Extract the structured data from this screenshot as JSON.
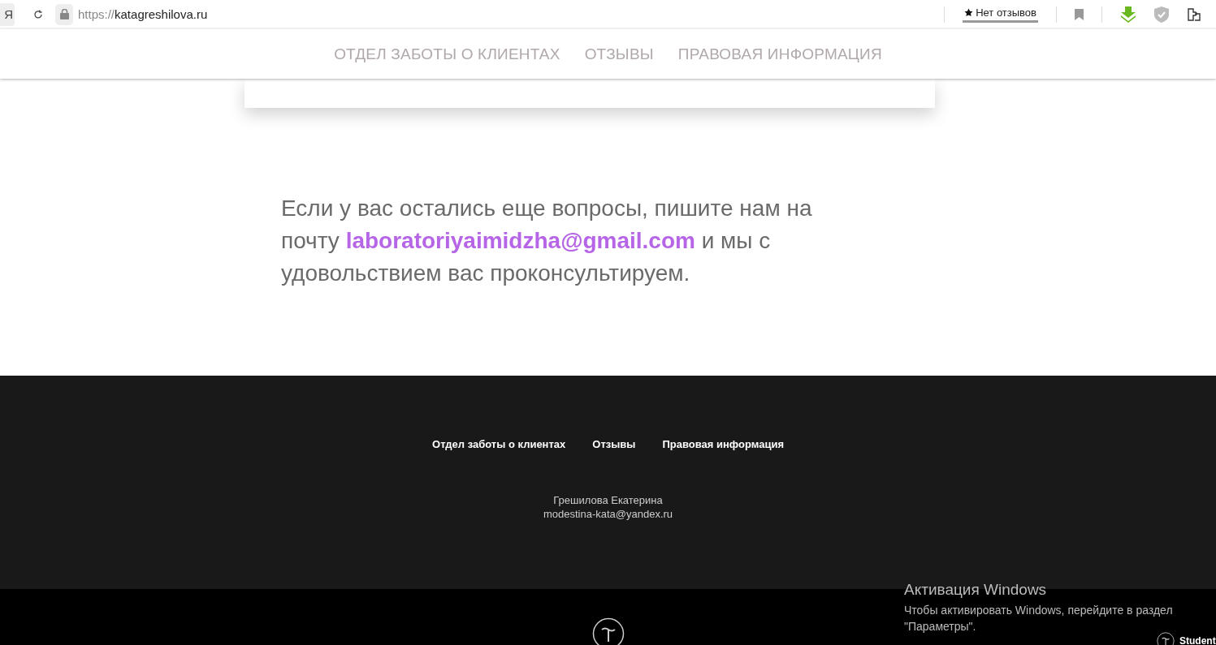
{
  "browser": {
    "url_scheme": "https://",
    "url_host": "katagreshilova.ru",
    "reviews": "Нет отзывов",
    "yandex_key": "Я"
  },
  "nav": {
    "items": [
      {
        "label": "ОТДЕЛ ЗАБОТЫ О КЛИЕНТАХ"
      },
      {
        "label": "ОТЗЫВЫ"
      },
      {
        "label": "ПРАВОВАЯ ИНФОРМАЦИЯ"
      }
    ]
  },
  "message": {
    "before": "Если у вас остались еще вопросы, пишите нам на почту ",
    "email": "laboratoriyaimidzha@gmail.com",
    "after": " и мы с удовольствием вас проконсультируем."
  },
  "footer": {
    "links": [
      {
        "label": "Отдел заботы о клиентах"
      },
      {
        "label": "Отзывы"
      },
      {
        "label": "Правовая информация"
      }
    ],
    "name": "Грешилова Екатерина",
    "email": "modestina-kata@yandex.ru"
  },
  "activation": {
    "title": "Активация Windows",
    "text": "Чтобы активировать Windows, перейдите в раздел \"Параметры\"."
  },
  "badge": {
    "label": "Student"
  }
}
